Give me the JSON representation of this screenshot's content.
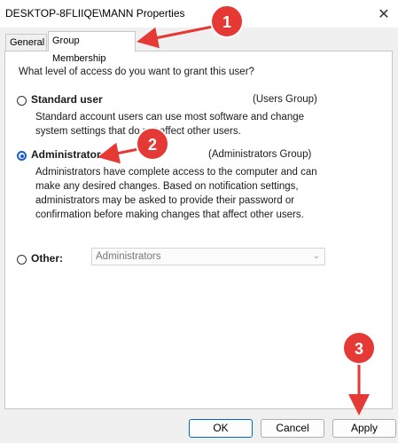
{
  "window": {
    "title": "DESKTOP-8FLIIQE\\MANN Properties",
    "close_glyph": "✕"
  },
  "tabs": [
    {
      "label": "General"
    },
    {
      "label": "Group Membership",
      "active": true
    }
  ],
  "panel": {
    "question": "What level of access do you want to grant this user?",
    "options": [
      {
        "label": "Standard user",
        "group": "(Users Group)",
        "checked": false,
        "description": "Standard account users can use most software and change system settings that do not affect other users."
      },
      {
        "label": "Administrator",
        "group": "(Administrators Group)",
        "checked": true,
        "description": "Administrators have complete access to the computer and can make any desired changes. Based on notification settings, administrators may be asked to provide their password or confirmation before making changes that affect other users."
      },
      {
        "label": "Other:",
        "checked": false,
        "dropdown_value": "Administrators"
      }
    ]
  },
  "buttons": {
    "ok": "OK",
    "cancel": "Cancel",
    "apply": "Apply"
  },
  "annotations": {
    "badges": [
      "1",
      "2",
      "3"
    ],
    "color": "#e53935"
  }
}
